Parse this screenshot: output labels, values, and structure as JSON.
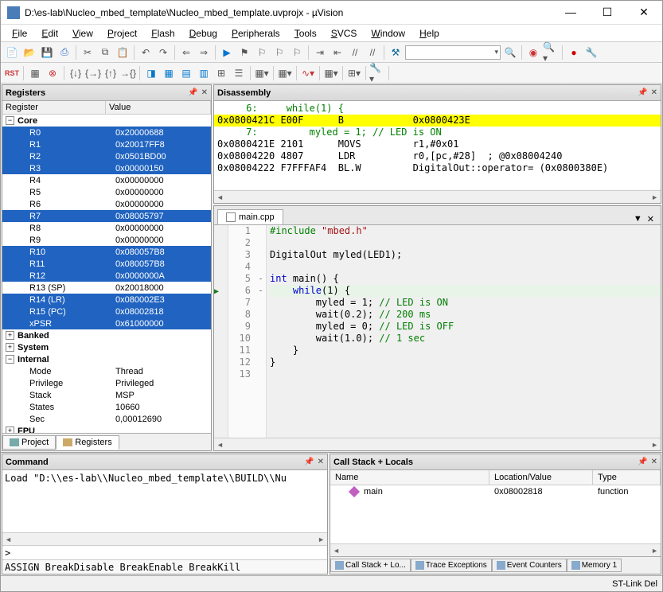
{
  "window": {
    "title": "D:\\es-lab\\Nucleo_mbed_template\\Nucleo_mbed_template.uvprojx - µVision"
  },
  "menu": [
    "File",
    "Edit",
    "View",
    "Project",
    "Flash",
    "Debug",
    "Peripherals",
    "Tools",
    "SVCS",
    "Window",
    "Help"
  ],
  "registers": {
    "title": "Registers",
    "col_name": "Register",
    "col_value": "Value",
    "groups": [
      {
        "label": "Core",
        "expanded": true,
        "rows": [
          {
            "n": "R0",
            "v": "0x20000688",
            "sel": true
          },
          {
            "n": "R1",
            "v": "0x20017FF8",
            "sel": true
          },
          {
            "n": "R2",
            "v": "0x0501BD00",
            "sel": true
          },
          {
            "n": "R3",
            "v": "0x00000150",
            "sel": true
          },
          {
            "n": "R4",
            "v": "0x00000000",
            "sel": false
          },
          {
            "n": "R5",
            "v": "0x00000000",
            "sel": false
          },
          {
            "n": "R6",
            "v": "0x00000000",
            "sel": false
          },
          {
            "n": "R7",
            "v": "0x08005797",
            "sel": true
          },
          {
            "n": "R8",
            "v": "0x00000000",
            "sel": false
          },
          {
            "n": "R9",
            "v": "0x00000000",
            "sel": false
          },
          {
            "n": "R10",
            "v": "0x080057B8",
            "sel": true
          },
          {
            "n": "R11",
            "v": "0x080057B8",
            "sel": true
          },
          {
            "n": "R12",
            "v": "0x0000000A",
            "sel": true
          },
          {
            "n": "R13 (SP)",
            "v": "0x20018000",
            "sel": false
          },
          {
            "n": "R14 (LR)",
            "v": "0x080002E3",
            "sel": true
          },
          {
            "n": "R15 (PC)",
            "v": "0x08002818",
            "sel": true
          },
          {
            "n": "xPSR",
            "v": "0x61000000",
            "sel": true
          }
        ]
      },
      {
        "label": "Banked",
        "expanded": false
      },
      {
        "label": "System",
        "expanded": false
      },
      {
        "label": "Internal",
        "expanded": true,
        "rows": [
          {
            "n": "Mode",
            "v": "Thread",
            "sel": false
          },
          {
            "n": "Privilege",
            "v": "Privileged",
            "sel": false
          },
          {
            "n": "Stack",
            "v": "MSP",
            "sel": false
          },
          {
            "n": "States",
            "v": "10660",
            "sel": false
          },
          {
            "n": "Sec",
            "v": "0,00012690",
            "sel": false
          }
        ]
      },
      {
        "label": "FPU",
        "expanded": false
      }
    ],
    "tabs": [
      "Project",
      "Registers"
    ],
    "active_tab": 1
  },
  "disassembly": {
    "title": "Disassembly",
    "lines": [
      {
        "t": "     6:     while(1) {",
        "cls": "src-green"
      },
      {
        "t": "0x0800421C E00F      B            0x0800423E",
        "cls": "hl-yellow"
      },
      {
        "t": "     7:         myled = 1; // LED is ON",
        "cls": "src-green"
      },
      {
        "t": "0x0800421E 2101      MOVS         r1,#0x01"
      },
      {
        "t": "0x08004220 4807      LDR          r0,[pc,#28]  ; @0x08004240"
      },
      {
        "t": "0x08004222 F7FFFAF4  BL.W         DigitalOut::operator= (0x0800380E)"
      }
    ]
  },
  "editor": {
    "filename": "main.cpp",
    "current_line": 6,
    "lines": [
      {
        "n": 1,
        "html": "<span class='pp'>#include</span> <span class='str'>\"mbed.h\"</span>"
      },
      {
        "n": 2,
        "html": ""
      },
      {
        "n": 3,
        "html": "DigitalOut myled(LED1);"
      },
      {
        "n": 4,
        "html": ""
      },
      {
        "n": 5,
        "html": "<span class='kw'>int</span> main() {",
        "fold": "-"
      },
      {
        "n": 6,
        "html": "    <span class='kw'>while</span>(1) {",
        "fold": "-",
        "cur": true
      },
      {
        "n": 7,
        "html": "        myled = 1; <span class='cmt'>// LED is ON</span>"
      },
      {
        "n": 8,
        "html": "        wait(0.2); <span class='cmt'>// 200 ms</span>"
      },
      {
        "n": 9,
        "html": "        myled = 0; <span class='cmt'>// LED is OFF</span>"
      },
      {
        "n": 10,
        "html": "        wait(1.0); <span class='cmt'>// 1 sec</span>"
      },
      {
        "n": 11,
        "html": "    }"
      },
      {
        "n": 12,
        "html": "}"
      },
      {
        "n": 13,
        "html": ""
      }
    ]
  },
  "command": {
    "title": "Command",
    "output": "Load \"D:\\\\es-lab\\\\Nucleo_mbed_template\\\\BUILD\\\\Nu",
    "prompt": ">",
    "hint": "ASSIGN BreakDisable BreakEnable BreakKill"
  },
  "callstack": {
    "title": "Call Stack + Locals",
    "cols": [
      "Name",
      "Location/Value",
      "Type"
    ],
    "rows": [
      {
        "name": "main",
        "loc": "0x08002818",
        "type": "function"
      }
    ],
    "tabs": [
      "Call Stack + Lo...",
      "Trace Exceptions",
      "Event Counters",
      "Memory 1"
    ]
  },
  "status": {
    "right": "ST-Link Del"
  }
}
